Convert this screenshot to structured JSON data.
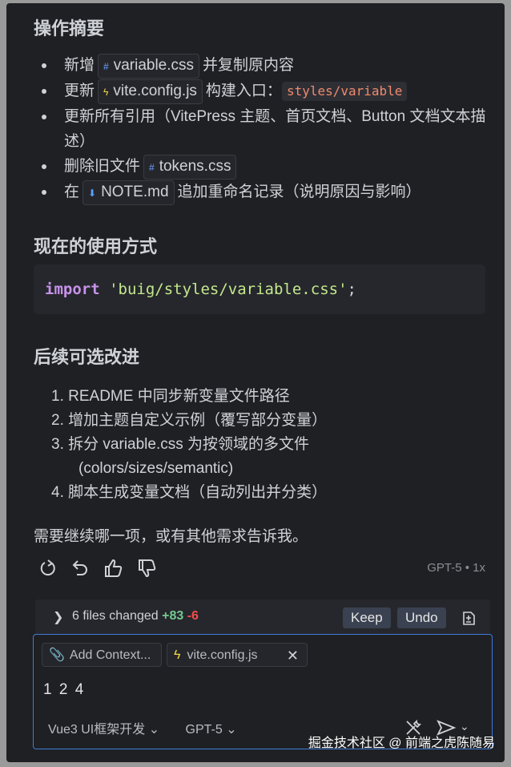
{
  "summary": {
    "heading": "操作摘要",
    "items": [
      {
        "before": "新增",
        "chip_icon": "css-file-icon",
        "chip": "variable.css",
        "after": "并复制原内容"
      },
      {
        "before": "更新",
        "chip_icon": "js-file-icon",
        "chip": "vite.config.js",
        "after": "构建入口：",
        "code": "styles/variable"
      },
      {
        "text": "更新所有引用（VitePress 主题、首页文档、Button 文档文本描述）"
      },
      {
        "before": "删除旧文件",
        "chip_icon": "css-file-icon",
        "chip": "tokens.css"
      },
      {
        "before": "在",
        "chip_icon": "markdown-file-icon",
        "chip": "NOTE.md",
        "after": "追加重命名记录（说明原因与影响）"
      }
    ]
  },
  "usage": {
    "heading": "现在的使用方式",
    "code_keyword": "import",
    "code_string": "'buig/styles/variable.css'",
    "code_punct": ";"
  },
  "next": {
    "heading": "后续可选改进",
    "steps": [
      {
        "num": "1.",
        "text": "README 中同步新变量文件路径"
      },
      {
        "num": "2.",
        "text": "增加主题自定义示例（覆写部分变量）"
      },
      {
        "num": "3.",
        "text": "拆分 variable.css 为按领域的多文件",
        "cont": "(colors/sizes/semantic)"
      },
      {
        "num": "4.",
        "text": "脚本生成变量文档（自动列出并分类）"
      }
    ]
  },
  "closing": "需要继续哪一项，或有其他需求告诉我。",
  "feedback": {
    "model": "GPT-5 • 1x"
  },
  "changes": {
    "label": "6 files changed",
    "added": "+83",
    "removed": "-6",
    "keep": "Keep",
    "undo": "Undo"
  },
  "composer": {
    "add_context": "Add Context...",
    "file_chip": "vite.config.js",
    "typed": "1 2 4",
    "mode": "Vue3 UI框架开发",
    "model": "GPT-5"
  },
  "watermark": "掘金技术社区 @ 前端之虎陈随易",
  "colors": {
    "accent": "#3f7bd6",
    "added": "#73c991",
    "removed": "#f14c4c",
    "inline_code": "#f08a6e"
  }
}
